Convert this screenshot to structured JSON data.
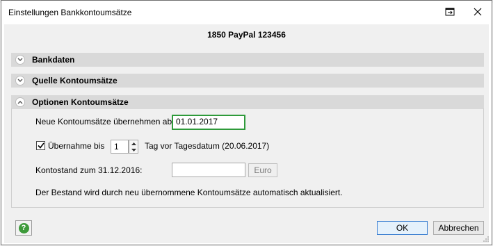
{
  "window": {
    "title": "Einstellungen Bankkontoumsätze"
  },
  "header": {
    "title": "1850 PayPal 123456"
  },
  "sections": {
    "bankdaten": {
      "label": "Bankdaten"
    },
    "quelle": {
      "label": "Quelle Kontoumsätze"
    },
    "optionen": {
      "label": "Optionen Kontoumsätze"
    }
  },
  "options": {
    "start_label": "Neue Kontoumsätze übernehmen ab:",
    "start_value": "01.01.2017",
    "uebernahme_label": "Übernahme bis",
    "uebernahme_checked": true,
    "uebernahme_value": "1",
    "uebernahme_suffix": "Tag vor Tagesdatum (20.06.2017)",
    "kontostand_label": "Kontostand zum 31.12.2016:",
    "kontostand_value": "",
    "unit": "Euro",
    "info": "Der Bestand wird durch neu übernommene Kontoumsätze automatisch aktualisiert."
  },
  "buttons": {
    "ok": "OK",
    "cancel": "Abbrechen"
  },
  "icons": {
    "restore": "restore-window-icon",
    "close": "close-icon",
    "expand": "chevron-down-icon",
    "collapse": "chevron-up-icon",
    "help": "help-icon",
    "check": "checkmark-icon"
  },
  "colors": {
    "focus_border": "#2e9a3a",
    "section_bg": "#d9d9d9",
    "ok_border": "#3c7fd1"
  }
}
